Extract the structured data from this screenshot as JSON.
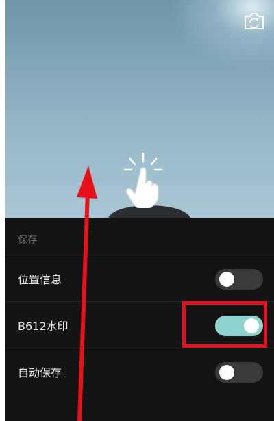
{
  "camera": {
    "switch_icon": "camera-switch-icon",
    "tap_hint_icon": "tap-hand-icon"
  },
  "settings": {
    "section_title": "保存",
    "rows": [
      {
        "label": "位置信息",
        "toggle": "off"
      },
      {
        "label": "B612水印",
        "toggle": "on"
      },
      {
        "label": "自动保存",
        "toggle": "off"
      }
    ]
  },
  "colors": {
    "toggle_on": "#8fd3d1",
    "toggle_off": "#3a3a3a",
    "panel_bg": "#141414",
    "annotation_red": "#e8101a"
  }
}
